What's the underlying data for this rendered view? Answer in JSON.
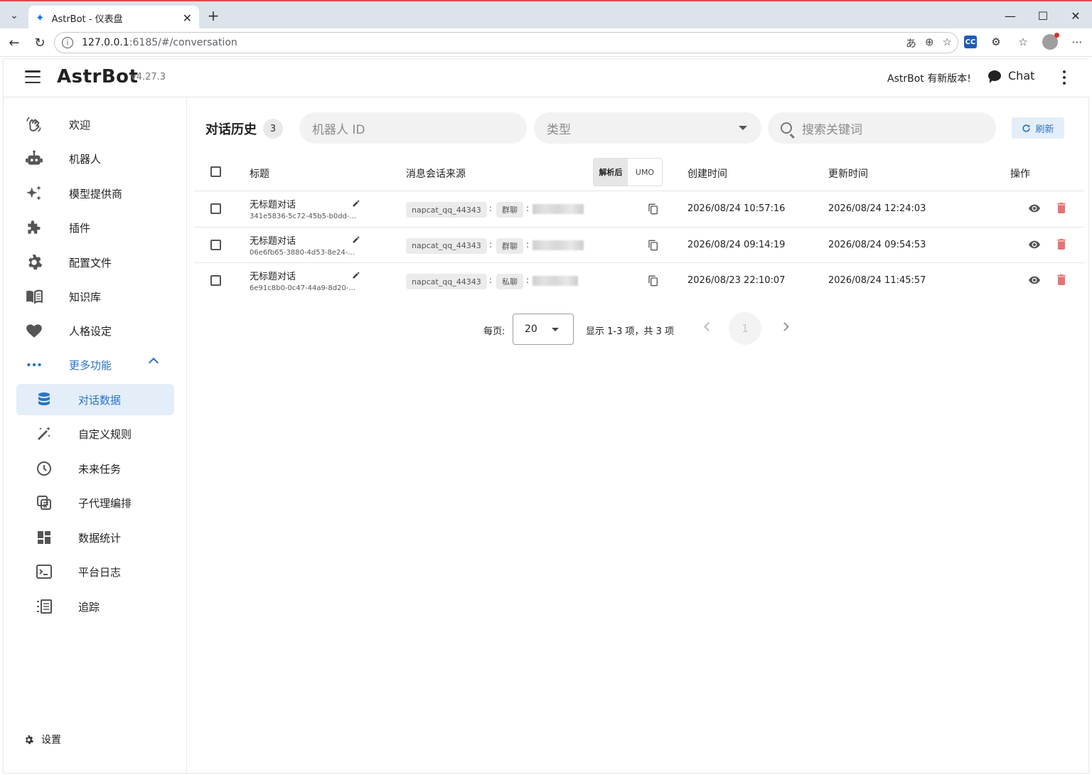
{
  "browser": {
    "tab_title": "AstrBot - 仪表盘",
    "url_host": "127.0.0.1",
    "url_path": ":6185/#/conversation"
  },
  "header": {
    "brand": "AstrBot",
    "version": "v4.27.3",
    "update_note": "AstrBot 有新版本!",
    "chat_label": "Chat"
  },
  "sidebar": {
    "items": [
      {
        "label": "欢迎",
        "icon": "waving-hand-icon"
      },
      {
        "label": "机器人",
        "icon": "robot-icon"
      },
      {
        "label": "模型提供商",
        "icon": "sparkle-icon"
      },
      {
        "label": "插件",
        "icon": "puzzle-icon"
      },
      {
        "label": "配置文件",
        "icon": "gear-icon"
      },
      {
        "label": "知识库",
        "icon": "book-icon"
      },
      {
        "label": "人格设定",
        "icon": "heart-icon"
      }
    ],
    "more_label": "更多功能",
    "sub_items": [
      {
        "label": "对话数据",
        "icon": "database-icon"
      },
      {
        "label": "自定义规则",
        "icon": "magic-wand-icon"
      },
      {
        "label": "未来任务",
        "icon": "clock-icon"
      },
      {
        "label": "子代理编排",
        "icon": "copy-layers-icon"
      },
      {
        "label": "数据统计",
        "icon": "dashboard-icon"
      },
      {
        "label": "平台日志",
        "icon": "console-icon"
      },
      {
        "label": "追踪",
        "icon": "list-tree-icon"
      }
    ],
    "settings_label": "设置"
  },
  "main": {
    "title": "对话历史",
    "count": "3",
    "filters": {
      "bot_id_placeholder": "机器人 ID",
      "type_placeholder": "类型",
      "search_placeholder": "搜索关键词"
    },
    "refresh_label": "刷新",
    "columns": {
      "title": "标题",
      "source": "消息会话来源",
      "toggle_parsed": "解析后",
      "toggle_umo": "UMO",
      "created": "创建时间",
      "updated": "更新时间",
      "actions": "操作"
    },
    "rows": [
      {
        "title": "无标题对话",
        "id": "341e5836-5c72-45b5-b0dd-...",
        "platform": "napcat_qq_44343",
        "kind": "群聊",
        "created": "2026/08/24 10:57:16",
        "updated": "2026/08/24 12:24:03"
      },
      {
        "title": "无标题对话",
        "id": "06e6fb65-3880-4d53-8e24-...",
        "platform": "napcat_qq_44343",
        "kind": "群聊",
        "created": "2026/08/24 09:14:19",
        "updated": "2026/08/24 09:54:53"
      },
      {
        "title": "无标题对话",
        "id": "6e91c8b0-0c47-44a9-8d20-...",
        "platform": "napcat_qq_44343",
        "kind": "私聊",
        "created": "2026/08/23 22:10:07",
        "updated": "2026/08/24 11:45:57"
      }
    ],
    "pagination": {
      "per_page_label": "每页:",
      "per_page_value": "20",
      "range_text": "显示 1-3 项，共 3 项",
      "current_page": "1"
    }
  },
  "colors": {
    "accent": "#2a73c5",
    "active_bg": "#e3eef9",
    "delete": "#e57373"
  }
}
